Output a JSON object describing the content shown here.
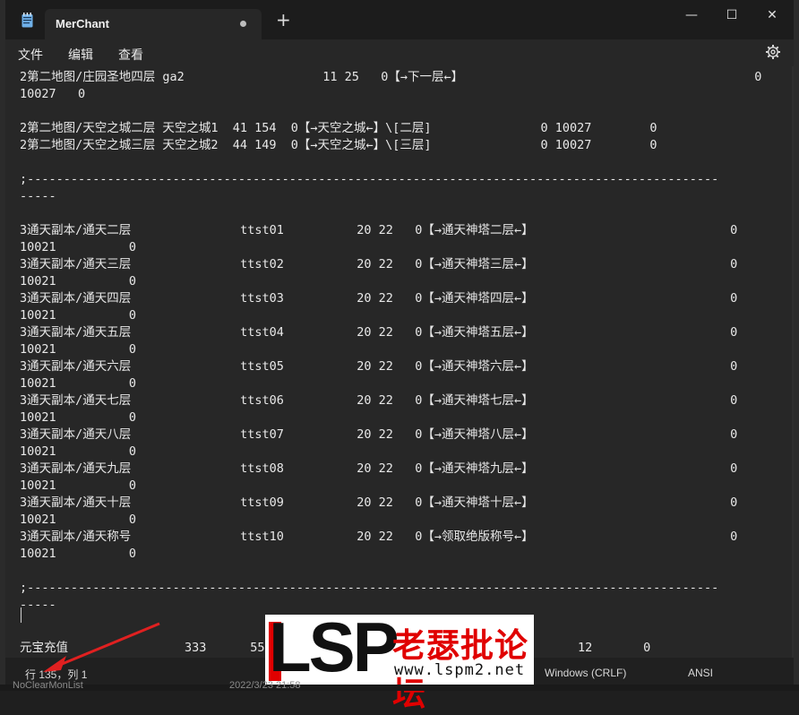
{
  "window": {
    "tab_title": "MerChant",
    "new_tab": "+",
    "minimize": "—",
    "maximize": "☐",
    "close": "✕"
  },
  "menu": {
    "file": "文件",
    "edit": "编辑",
    "view": "查看"
  },
  "editor_lines": [
    "2第二地图/庄园圣地四层 ga2                   11 25   0【→下一层←】                                        0",
    "10027   0",
    "",
    "2第二地图/天空之城二层 天空之城1  41 154  0【→天空之城←】\\[二层]               0 10027        0",
    "2第二地图/天空之城三层 天空之城2  44 149  0【→天空之城←】\\[三层]               0 10027        0",
    "",
    ";-----------------------------------------------------------------------------------------------",
    "-----",
    "",
    "3通天副本/通天二层               ttst01          20 22   0【→通天神塔二层←】                           0",
    "10021          0",
    "3通天副本/通天三层               ttst02          20 22   0【→通天神塔三层←】                           0",
    "10021          0",
    "3通天副本/通天四层               ttst03          20 22   0【→通天神塔四层←】                           0",
    "10021          0",
    "3通天副本/通天五层               ttst04          20 22   0【→通天神塔五层←】                           0",
    "10021          0",
    "3通天副本/通天六层               ttst05          20 22   0【→通天神塔六层←】                           0",
    "10021          0",
    "3通天副本/通天七层               ttst06          20 22   0【→通天神塔七层←】                           0",
    "10021          0",
    "3通天副本/通天八层               ttst07          20 22   0【→通天神塔八层←】                           0",
    "10021          0",
    "3通天副本/通天九层               ttst08          20 22   0【→通天神塔九层←】                           0",
    "10021          0",
    "3通天副本/通天十层               ttst09          20 22   0【→通天神塔十层←】                           0",
    "10021          0",
    "3通天副本/通天称号               ttst10          20 22   0【→领取绝版称号←】                           0",
    "10021          0",
    "",
    ";-----------------------------------------------------------------------------------------------",
    "-----",
    "",
    "",
    "元宝充值                333      55                                           12       0"
  ],
  "status": {
    "position": "行 135，列 1",
    "line_ending": "Windows (CRLF)",
    "encoding": "ANSI"
  },
  "watermark": {
    "logo": "LSP",
    "cn": "老瑟批论坛",
    "url": "www.lspm2.net"
  },
  "background_list": {
    "file": "NoClearMonList",
    "date": "2022/3/23 21:58"
  },
  "colors": {
    "titlebar": "#1c1c1c",
    "editor_bg": "#272727",
    "text": "#e8e8e8",
    "watermark_red": "#e00000",
    "arrow_red": "#e02020"
  }
}
